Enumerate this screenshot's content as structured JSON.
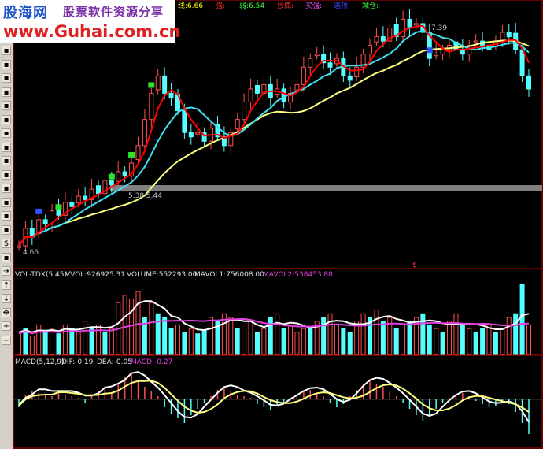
{
  "logo": {
    "brand": "股海网",
    "subtitle": "股票软件资源分享",
    "url": "www.Guhai.com.cn"
  },
  "header": {
    "items": [
      {
        "label": "线:6.66",
        "color": "#ffff00"
      },
      {
        "label": "强:-",
        "color": "#ff3030"
      },
      {
        "label": "弱:6.54",
        "color": "#40ff40"
      },
      {
        "label": "抄底:-",
        "color": "#ff3030"
      },
      {
        "label": "买强:-",
        "color": "#ff50ff"
      },
      {
        "label": "逃顶:-",
        "color": "#4040ff"
      },
      {
        "label": "减仓:-",
        "color": "#40ff40"
      }
    ]
  },
  "price_panel": {
    "high_label": "7.39",
    "low_label": "4.66",
    "band_label": "5.38 5.44"
  },
  "volume_panel": {
    "title": "VOL-TDX(5,45)",
    "vvol": "VVOL:926925.31",
    "volume": "VOLUME:552293.00",
    "mavol1": "MAVOL1:756008.00",
    "mavol2": "MAVOL2:538453.88"
  },
  "macd_panel": {
    "title": "MACD(5,12,9)",
    "dif": "DIF:-0.19",
    "dea": "DEA:-0.05",
    "macd": "MACD:-0.27"
  },
  "marker_symbol": "$",
  "toolbar_icons": [
    "chart-icon",
    "list-icon",
    "grid-icon",
    "table-icon",
    "bar-icon",
    "people-icon",
    "pie-icon",
    "info-icon",
    "news-icon",
    "card-icon",
    "signal-icon",
    "rsi-icon",
    "table2-icon",
    "bar2-icon",
    "dollar-icon",
    "tools-icon",
    "exit-icon",
    "up-arrow-icon",
    "down-arrow-icon",
    "move-icon",
    "zoom-in-icon",
    "zoom-out-icon"
  ],
  "colors": {
    "up": "#ff5050",
    "down": "#54ffff",
    "ma_short": "#ff0000",
    "ma_mid": "#40e0f0",
    "ma_long": "#ffff80",
    "divider": "#c00000"
  },
  "chart_data": [
    {
      "type": "candlestick",
      "closes": [
        4.75,
        4.95,
        4.85,
        5.05,
        5.0,
        5.15,
        5.1,
        5.25,
        5.2,
        5.32,
        5.28,
        5.4,
        5.35,
        5.5,
        5.45,
        5.6,
        5.55,
        5.7,
        5.9,
        6.2,
        6.5,
        6.7,
        6.5,
        6.45,
        6.3,
        6.05,
        6.0,
        6.05,
        5.95,
        6.1,
        6.0,
        5.9,
        6.05,
        6.2,
        6.4,
        6.55,
        6.5,
        6.6,
        6.45,
        6.55,
        6.4,
        6.5,
        6.6,
        6.8,
        6.9,
        6.95,
        6.85,
        6.8,
        6.9,
        6.7,
        6.65,
        6.8,
        6.95,
        7.05,
        7.15,
        7.1,
        7.25,
        7.15,
        7.35,
        7.25,
        7.3,
        7.2,
        6.9,
        6.95,
        7.0,
        7.05,
        7.0,
        6.95,
        7.05,
        7.1,
        7.05,
        7.0,
        7.1,
        7.2,
        7.15,
        7.0,
        6.7,
        6.55
      ],
      "high": 7.39,
      "low": 4.66
    },
    {
      "type": "bar",
      "name": "VOL-TDX(5,45)",
      "values": [
        0.3,
        0.35,
        0.25,
        0.4,
        0.3,
        0.35,
        0.28,
        0.4,
        0.35,
        0.3,
        0.45,
        0.35,
        0.4,
        0.3,
        0.35,
        0.7,
        0.8,
        0.75,
        0.85,
        0.5,
        0.7,
        0.55,
        0.5,
        0.35,
        0.4,
        0.3,
        0.35,
        0.28,
        0.32,
        0.5,
        0.45,
        0.55,
        0.5,
        0.35,
        0.4,
        0.45,
        0.3,
        0.35,
        0.5,
        0.55,
        0.35,
        0.4,
        0.3,
        0.35,
        0.38,
        0.45,
        0.5,
        0.55,
        0.4,
        0.35,
        0.3,
        0.45,
        0.55,
        0.5,
        0.6,
        0.45,
        0.5,
        0.35,
        0.4,
        0.45,
        0.5,
        0.55,
        0.4,
        0.35,
        0.3,
        0.45,
        0.55,
        0.4,
        0.35,
        0.3,
        0.35,
        0.4,
        0.3,
        0.35,
        0.5,
        0.55,
        0.95,
        0.4
      ],
      "down_flags": [
        0,
        1,
        0,
        0,
        1,
        0,
        1,
        0,
        1,
        0,
        0,
        1,
        0,
        1,
        0,
        0,
        0,
        0,
        0,
        1,
        0,
        1,
        1,
        1,
        0,
        1,
        0,
        1,
        1,
        0,
        1,
        0,
        0,
        1,
        0,
        0,
        1,
        0,
        1,
        0,
        1,
        0,
        0,
        0,
        1,
        0,
        1,
        0,
        0,
        1,
        1,
        0,
        0,
        1,
        0,
        1,
        0,
        1,
        0,
        1,
        0,
        1,
        1,
        0,
        1,
        0,
        0,
        1,
        0,
        1,
        1,
        0,
        1,
        0,
        0,
        1,
        1,
        0
      ]
    },
    {
      "type": "bar",
      "name": "MACD(5,12,9)",
      "values": [
        -0.05,
        0.03,
        0.05,
        0.04,
        0.03,
        0.02,
        0.04,
        0.03,
        0.02,
        0.01,
        -0.02,
        0.02,
        0.05,
        0.08,
        0.04,
        0.1,
        0.14,
        0.16,
        0.12,
        0.08,
        0.05,
        0.02,
        -0.05,
        -0.09,
        -0.12,
        -0.15,
        -0.1,
        -0.06,
        -0.02,
        0.02,
        0.06,
        0.08,
        0.05,
        0.03,
        0.02,
        0.01,
        -0.03,
        -0.05,
        -0.07,
        -0.04,
        -0.02,
        0.01,
        0.03,
        0.05,
        0.06,
        0.04,
        0.02,
        -0.02,
        -0.05,
        -0.03,
        0.02,
        0.06,
        0.1,
        0.12,
        0.1,
        0.08,
        0.05,
        0.02,
        -0.02,
        -0.06,
        -0.1,
        -0.14,
        -0.1,
        -0.06,
        -0.02,
        0.01,
        0.03,
        0.04,
        0.02,
        -0.01,
        -0.03,
        -0.05,
        -0.04,
        -0.02,
        -0.03,
        -0.08,
        -0.15,
        -0.22
      ]
    }
  ]
}
